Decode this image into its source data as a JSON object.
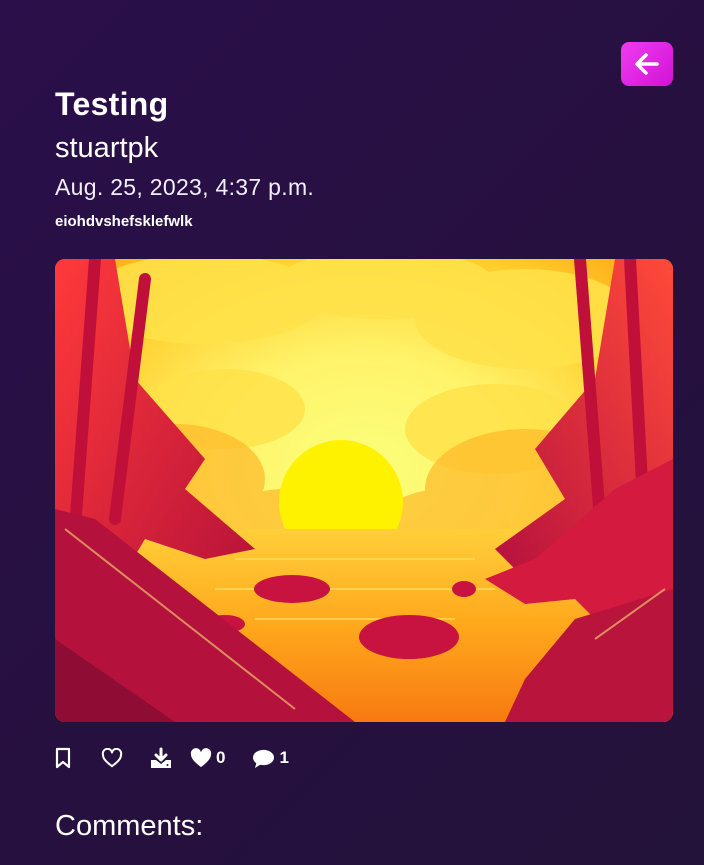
{
  "post": {
    "title": "Testing",
    "author": "stuartpk",
    "date": "Aug. 25, 2023, 4:37 p.m.",
    "description": "eiohdvshefsklefwlk"
  },
  "actions": {
    "likes_count": "0",
    "comments_count": "1"
  },
  "comments": {
    "heading": "Comments:"
  },
  "icons": {
    "back": "arrow-left-icon",
    "bookmark": "bookmark-icon",
    "like": "heart-outline-icon",
    "download": "download-icon",
    "likes": "heart-filled-icon",
    "comments": "speech-bubble-icon"
  },
  "colors": {
    "background": "#26103f",
    "accent": "#e026e6",
    "text": "#ffffff"
  }
}
